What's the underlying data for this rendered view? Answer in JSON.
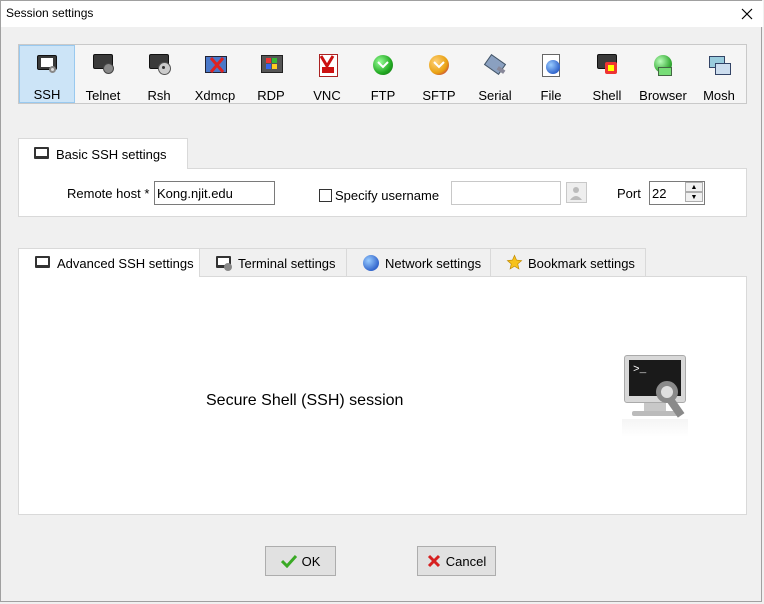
{
  "window": {
    "title": "Session settings",
    "close_icon": "close-icon"
  },
  "toolbar": {
    "items": [
      {
        "label": "SSH",
        "icon": "terminal-key-icon"
      },
      {
        "label": "Telnet",
        "icon": "terminal-plug-icon"
      },
      {
        "label": "Rsh",
        "icon": "terminal-disk-icon"
      },
      {
        "label": "Xdmcp",
        "icon": "x-display-icon"
      },
      {
        "label": "RDP",
        "icon": "windows-desktop-icon"
      },
      {
        "label": "VNC",
        "icon": "vnc-icon"
      },
      {
        "label": "FTP",
        "icon": "ftp-icon"
      },
      {
        "label": "SFTP",
        "icon": "sftp-icon"
      },
      {
        "label": "Serial",
        "icon": "serial-plug-icon"
      },
      {
        "label": "File",
        "icon": "file-globe-icon"
      },
      {
        "label": "Shell",
        "icon": "shell-icon"
      },
      {
        "label": "Browser",
        "icon": "browser-icon"
      },
      {
        "label": "Mosh",
        "icon": "mosh-icon"
      }
    ],
    "selected": "SSH"
  },
  "basic": {
    "tab_label": "Basic SSH settings",
    "remote_host_label": "Remote host *",
    "remote_host_value": "Kong.njit.edu",
    "specify_username_label": "Specify username",
    "username_value": "",
    "port_label": "Port",
    "port_value": "22"
  },
  "subtabs": [
    {
      "label": "Advanced SSH settings",
      "icon": "terminal-icon"
    },
    {
      "label": "Terminal settings",
      "icon": "terminal-settings-icon"
    },
    {
      "label": "Network settings",
      "icon": "globe-icon"
    },
    {
      "label": "Bookmark settings",
      "icon": "star-icon"
    }
  ],
  "main": {
    "description": "Secure Shell (SSH) session"
  },
  "buttons": {
    "ok": "OK",
    "cancel": "Cancel"
  },
  "colors": {
    "selected_bg": "#cce4f7",
    "selected_border": "#99c9ef"
  }
}
